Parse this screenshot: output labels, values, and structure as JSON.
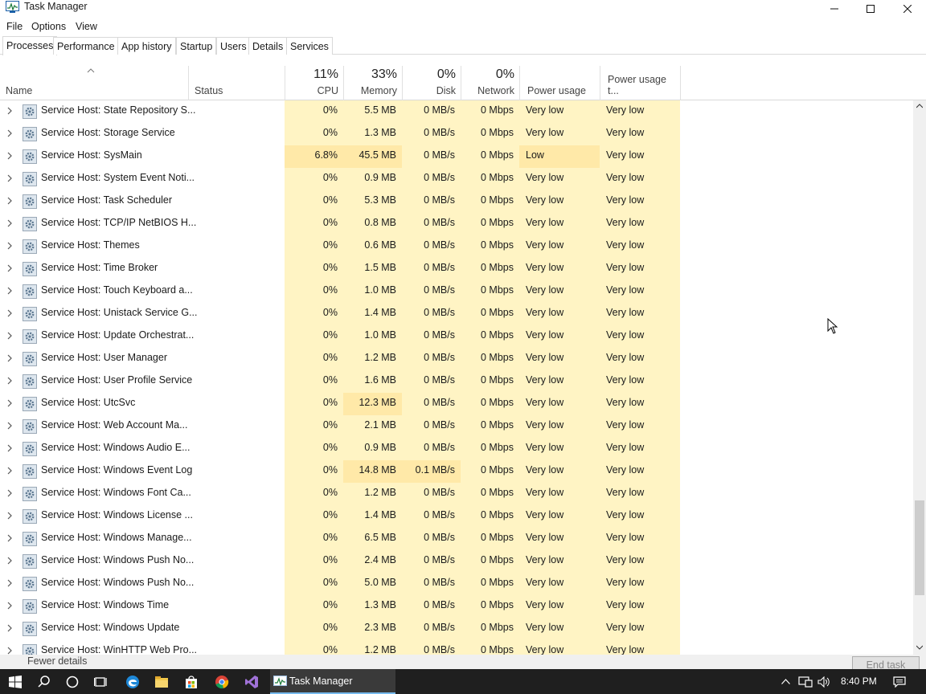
{
  "window": {
    "title": "Task Manager"
  },
  "menu": [
    "File",
    "Options",
    "View"
  ],
  "tabs": [
    "Processes",
    "Performance",
    "App history",
    "Startup",
    "Users",
    "Details",
    "Services"
  ],
  "columns": {
    "name": "Name",
    "status": "Status",
    "cpu": {
      "pct": "11%",
      "label": "CPU"
    },
    "memory": {
      "pct": "33%",
      "label": "Memory"
    },
    "disk": {
      "pct": "0%",
      "label": "Disk"
    },
    "network": {
      "pct": "0%",
      "label": "Network"
    },
    "power": "Power usage",
    "power_trend": "Power usage t..."
  },
  "rows": [
    {
      "name": "Service Host: State Repository S...",
      "cpu": "0%",
      "mem": "5.5 MB",
      "disk": "0 MB/s",
      "net": "0 Mbps",
      "power": "Very low",
      "trend": "Very low"
    },
    {
      "name": "Service Host: Storage Service",
      "cpu": "0%",
      "mem": "1.3 MB",
      "disk": "0 MB/s",
      "net": "0 Mbps",
      "power": "Very low",
      "trend": "Very low"
    },
    {
      "name": "Service Host: SysMain",
      "cpu": "6.8%",
      "mem": "45.5 MB",
      "disk": "0 MB/s",
      "net": "0 Mbps",
      "power": "Low",
      "trend": "Very low"
    },
    {
      "name": "Service Host: System Event Noti...",
      "cpu": "0%",
      "mem": "0.9 MB",
      "disk": "0 MB/s",
      "net": "0 Mbps",
      "power": "Very low",
      "trend": "Very low"
    },
    {
      "name": "Service Host: Task Scheduler",
      "cpu": "0%",
      "mem": "5.3 MB",
      "disk": "0 MB/s",
      "net": "0 Mbps",
      "power": "Very low",
      "trend": "Very low"
    },
    {
      "name": "Service Host: TCP/IP NetBIOS H...",
      "cpu": "0%",
      "mem": "0.8 MB",
      "disk": "0 MB/s",
      "net": "0 Mbps",
      "power": "Very low",
      "trend": "Very low"
    },
    {
      "name": "Service Host: Themes",
      "cpu": "0%",
      "mem": "0.6 MB",
      "disk": "0 MB/s",
      "net": "0 Mbps",
      "power": "Very low",
      "trend": "Very low"
    },
    {
      "name": "Service Host: Time Broker",
      "cpu": "0%",
      "mem": "1.5 MB",
      "disk": "0 MB/s",
      "net": "0 Mbps",
      "power": "Very low",
      "trend": "Very low"
    },
    {
      "name": "Service Host: Touch Keyboard a...",
      "cpu": "0%",
      "mem": "1.0 MB",
      "disk": "0 MB/s",
      "net": "0 Mbps",
      "power": "Very low",
      "trend": "Very low"
    },
    {
      "name": "Service Host: Unistack Service G...",
      "cpu": "0%",
      "mem": "1.4 MB",
      "disk": "0 MB/s",
      "net": "0 Mbps",
      "power": "Very low",
      "trend": "Very low"
    },
    {
      "name": "Service Host: Update Orchestrat...",
      "cpu": "0%",
      "mem": "1.0 MB",
      "disk": "0 MB/s",
      "net": "0 Mbps",
      "power": "Very low",
      "trend": "Very low"
    },
    {
      "name": "Service Host: User Manager",
      "cpu": "0%",
      "mem": "1.2 MB",
      "disk": "0 MB/s",
      "net": "0 Mbps",
      "power": "Very low",
      "trend": "Very low"
    },
    {
      "name": "Service Host: User Profile Service",
      "cpu": "0%",
      "mem": "1.6 MB",
      "disk": "0 MB/s",
      "net": "0 Mbps",
      "power": "Very low",
      "trend": "Very low"
    },
    {
      "name": "Service Host: UtcSvc",
      "cpu": "0%",
      "mem": "12.3 MB",
      "disk": "0 MB/s",
      "net": "0 Mbps",
      "power": "Very low",
      "trend": "Very low"
    },
    {
      "name": "Service Host: Web Account Ma...",
      "cpu": "0%",
      "mem": "2.1 MB",
      "disk": "0 MB/s",
      "net": "0 Mbps",
      "power": "Very low",
      "trend": "Very low"
    },
    {
      "name": "Service Host: Windows Audio E...",
      "cpu": "0%",
      "mem": "0.9 MB",
      "disk": "0 MB/s",
      "net": "0 Mbps",
      "power": "Very low",
      "trend": "Very low"
    },
    {
      "name": "Service Host: Windows Event Log",
      "cpu": "0%",
      "mem": "14.8 MB",
      "disk": "0.1 MB/s",
      "net": "0 Mbps",
      "power": "Very low",
      "trend": "Very low"
    },
    {
      "name": "Service Host: Windows Font Ca...",
      "cpu": "0%",
      "mem": "1.2 MB",
      "disk": "0 MB/s",
      "net": "0 Mbps",
      "power": "Very low",
      "trend": "Very low"
    },
    {
      "name": "Service Host: Windows License ...",
      "cpu": "0%",
      "mem": "1.4 MB",
      "disk": "0 MB/s",
      "net": "0 Mbps",
      "power": "Very low",
      "trend": "Very low"
    },
    {
      "name": "Service Host: Windows Manage...",
      "cpu": "0%",
      "mem": "6.5 MB",
      "disk": "0 MB/s",
      "net": "0 Mbps",
      "power": "Very low",
      "trend": "Very low"
    },
    {
      "name": "Service Host: Windows Push No...",
      "cpu": "0%",
      "mem": "2.4 MB",
      "disk": "0 MB/s",
      "net": "0 Mbps",
      "power": "Very low",
      "trend": "Very low"
    },
    {
      "name": "Service Host: Windows Push No...",
      "cpu": "0%",
      "mem": "5.0 MB",
      "disk": "0 MB/s",
      "net": "0 Mbps",
      "power": "Very low",
      "trend": "Very low"
    },
    {
      "name": "Service Host: Windows Time",
      "cpu": "0%",
      "mem": "1.3 MB",
      "disk": "0 MB/s",
      "net": "0 Mbps",
      "power": "Very low",
      "trend": "Very low"
    },
    {
      "name": "Service Host: Windows Update",
      "cpu": "0%",
      "mem": "2.3 MB",
      "disk": "0 MB/s",
      "net": "0 Mbps",
      "power": "Very low",
      "trend": "Very low"
    },
    {
      "name": "Service Host: WinHTTP Web Pro...",
      "cpu": "0%",
      "mem": "1.2 MB",
      "disk": "0 MB/s",
      "net": "0 Mbps",
      "power": "Very low",
      "trend": "Very low"
    }
  ],
  "footer": {
    "fewer_details": "Fewer details",
    "end_task": "End task"
  },
  "taskbar": {
    "active_app": "Task Manager",
    "clock": "8:40 PM"
  },
  "colors": {
    "heat_light": "#fff4c4",
    "heat_medium": "#ffe9a8",
    "taskbar": "#1f1f1f",
    "active_accent": "#76b9ed"
  },
  "icons": [
    "task-manager-icon",
    "minimize-icon",
    "maximize-icon",
    "close-icon",
    "gear-icon",
    "chevron-right-icon",
    "start-icon",
    "search-icon",
    "cortana-icon",
    "task-view-icon",
    "edge-icon",
    "file-explorer-icon",
    "store-icon",
    "chrome-icon",
    "visual-studio-icon",
    "network-icon",
    "volume-icon",
    "notification-icon"
  ]
}
